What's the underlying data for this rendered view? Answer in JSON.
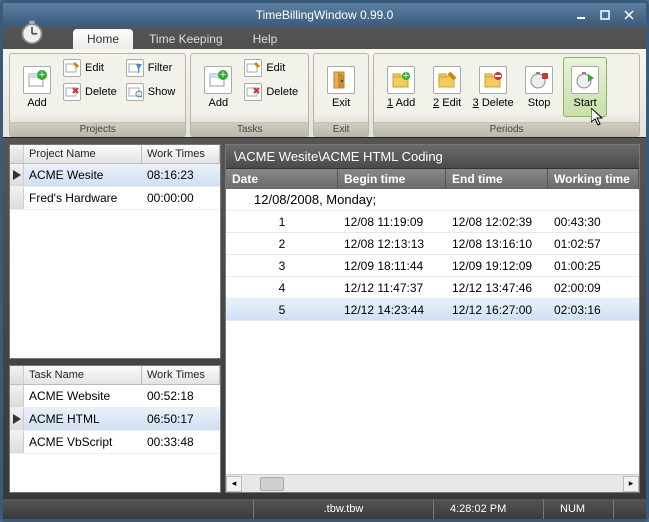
{
  "window": {
    "title": "TimeBillingWindow 0.99.0"
  },
  "tabs": {
    "home": "Home",
    "timekeeping": "Time Keeping",
    "help": "Help"
  },
  "ribbon": {
    "projects": {
      "label": "Projects",
      "add": "Add",
      "edit": "Edit",
      "filter": "Filter",
      "delete": "Delete",
      "show": "Show"
    },
    "tasks": {
      "label": "Tasks",
      "add": "Add",
      "edit": "Edit",
      "delete": "Delete"
    },
    "exit": {
      "label": "Exit",
      "exit": "Exit"
    },
    "periods": {
      "label": "Periods",
      "badd": {
        "accel": "1",
        "text": "Add"
      },
      "bedit": {
        "accel": "2",
        "text": "Edit"
      },
      "bdelete": {
        "accel": "3",
        "text": "Delete"
      },
      "stop": "Stop",
      "start": "Start"
    }
  },
  "projectGrid": {
    "cols": {
      "name": "Project Name",
      "wt": "Work Times"
    },
    "rows": [
      {
        "name": "ACME Wesite",
        "wt": "08:16:23",
        "selected": true,
        "current": true
      },
      {
        "name": "Fred's Hardware",
        "wt": "00:00:00",
        "selected": false,
        "current": false
      }
    ]
  },
  "taskGrid": {
    "cols": {
      "name": "Task Name",
      "wt": "Work Times"
    },
    "rows": [
      {
        "name": "ACME Website",
        "wt": "00:52:18",
        "selected": false,
        "current": false
      },
      {
        "name": "ACME HTML",
        "wt": "06:50:17",
        "selected": true,
        "current": true
      },
      {
        "name": "ACME VbScript",
        "wt": "00:33:48",
        "selected": false,
        "current": false
      }
    ]
  },
  "periods": {
    "breadcrumb": "\\ACME Wesite\\ACME HTML Coding",
    "cols": {
      "date": "Date",
      "begin": "Begin time",
      "end": "End time",
      "work": "Working time"
    },
    "groupLabel": "12/08/2008, Monday;",
    "rows": [
      {
        "n": "1",
        "begin": "12/08 11:19:09",
        "end": "12/08 12:02:39",
        "work": "00:43:30",
        "selected": false
      },
      {
        "n": "2",
        "begin": "12/08 12:13:13",
        "end": "12/08 13:16:10",
        "work": "01:02:57",
        "selected": false
      },
      {
        "n": "3",
        "begin": "12/09 18:11:44",
        "end": "12/09 19:12:09",
        "work": "01:00:25",
        "selected": false
      },
      {
        "n": "4",
        "begin": "12/12 11:47:37",
        "end": "12/12 13:47:46",
        "work": "02:00:09",
        "selected": false
      },
      {
        "n": "5",
        "begin": "12/12 14:23:44",
        "end": "12/12 16:27:00",
        "work": "02:03:16",
        "selected": true
      }
    ]
  },
  "status": {
    "file": ".tbw.tbw",
    "time": "4:28:02 PM",
    "num": "NUM"
  }
}
